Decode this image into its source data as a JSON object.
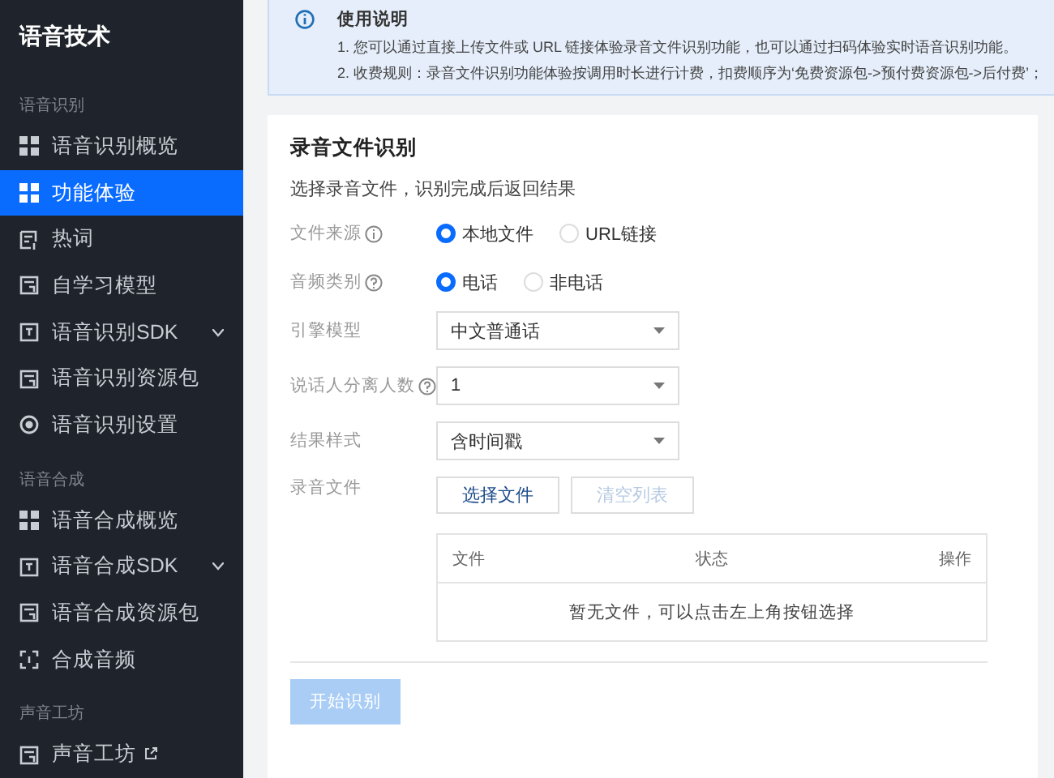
{
  "sidebar": {
    "title": "语音技术",
    "sections": [
      {
        "heading": "语音识别",
        "items": [
          {
            "label": "语音识别概览",
            "kind": "grid",
            "selected": false
          },
          {
            "label": "功能体验",
            "kind": "grid",
            "selected": true
          },
          {
            "label": "热词",
            "kind": "edit",
            "selected": false
          },
          {
            "label": "自学习模型",
            "kind": "doc",
            "selected": false
          },
          {
            "label": "语音识别SDK",
            "kind": "box",
            "selected": false,
            "expanded": false
          },
          {
            "label": "语音识别资源包",
            "kind": "doc",
            "selected": false
          },
          {
            "label": "语音识别设置",
            "kind": "gear",
            "selected": false
          }
        ]
      },
      {
        "heading": "语音合成",
        "items": [
          {
            "label": "语音合成概览",
            "kind": "grid",
            "selected": false
          },
          {
            "label": "语音合成SDK",
            "kind": "box",
            "selected": false,
            "expanded": false
          },
          {
            "label": "语音合成资源包",
            "kind": "doc",
            "selected": false
          },
          {
            "label": "合成音频",
            "kind": "frame",
            "selected": false
          }
        ]
      },
      {
        "heading": "声音工坊",
        "items": [
          {
            "label": "声音工坊",
            "kind": "doc",
            "selected": false,
            "external": true
          }
        ]
      }
    ]
  },
  "notice": {
    "title": "使用说明",
    "lines": [
      "1. 您可以通过直接上传文件或 URL 链接体验录音文件识别功能，也可以通过扫码体验实时语音识别功能。",
      "2. 收费规则：录音文件识别功能体验按调用时长进行计费，扣费顺序为‘免费资源包->预付费资源包->后付费’；"
    ]
  },
  "form": {
    "title": "录音文件识别",
    "subtitle": "选择录音文件，识别完成后返回结果",
    "fields": [
      {
        "kind": "radio",
        "label": "文件来源",
        "help": true,
        "options": [
          {
            "label": "本地文件",
            "selected": true
          },
          {
            "label": "URL链接",
            "selected": false
          }
        ]
      },
      {
        "kind": "radio",
        "label": "音频类别",
        "help": true,
        "options": [
          {
            "label": "电话",
            "selected": true
          },
          {
            "label": "非电话",
            "selected": false
          }
        ]
      },
      {
        "kind": "select",
        "label": "引擎模型",
        "value": "中文普通话"
      },
      {
        "kind": "select",
        "label": "说话人分离人数",
        "help": true,
        "value": "1"
      },
      {
        "kind": "select",
        "label": "结果样式",
        "value": "含时间戳"
      },
      {
        "kind": "buttons",
        "label": "录音文件",
        "buttons": [
          {
            "label": "选择文件",
            "disabled": false
          },
          {
            "label": "清空列表",
            "disabled": true
          }
        ]
      }
    ],
    "table": {
      "columns": [
        "文件",
        "状态",
        "操作"
      ],
      "empty": "暂无文件，可以点击左上角按钮选择"
    },
    "submit": {
      "label": "开始识别",
      "disabled": true
    }
  }
}
